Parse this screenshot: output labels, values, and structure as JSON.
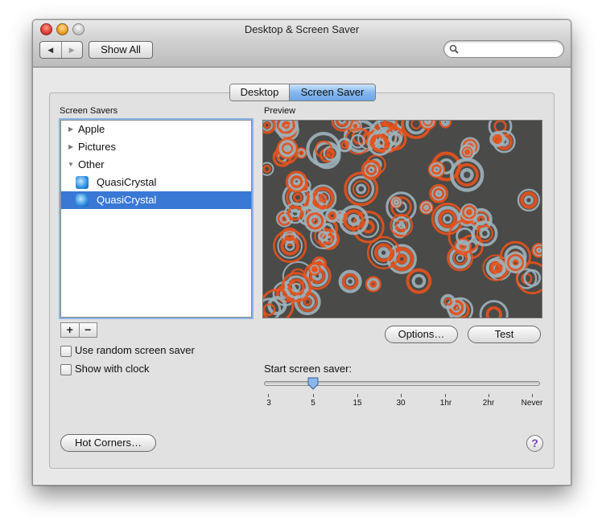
{
  "window": {
    "title": "Desktop & Screen Saver"
  },
  "toolbar": {
    "back_glyph": "◀",
    "forward_glyph": "▶",
    "show_all_label": "Show All",
    "search_placeholder": ""
  },
  "tabs": [
    {
      "label": "Desktop",
      "selected": false
    },
    {
      "label": "Screen Saver",
      "selected": true
    }
  ],
  "screen_savers": {
    "heading": "Screen Savers",
    "items": [
      {
        "label": "Apple",
        "type": "group",
        "expanded": false
      },
      {
        "label": "Pictures",
        "type": "group",
        "expanded": false
      },
      {
        "label": "Other",
        "type": "group",
        "expanded": true
      },
      {
        "label": "QuasiCrystal",
        "type": "item",
        "icon": "quasicrystal-icon",
        "selected": false
      },
      {
        "label": "QuasiCrystal",
        "type": "item",
        "icon": "quasicrystal-icon",
        "selected": true
      }
    ],
    "add_glyph": "+",
    "remove_glyph": "−"
  },
  "options": {
    "random_label": "Use random screen saver",
    "random_checked": false,
    "clock_label": "Show with clock",
    "clock_checked": false
  },
  "preview": {
    "heading": "Preview",
    "options_label": "Options…",
    "test_label": "Test"
  },
  "start": {
    "label": "Start screen saver:",
    "ticks": [
      "3",
      "5",
      "15",
      "30",
      "1hr",
      "2hr",
      "Never"
    ],
    "selected_tick": "5"
  },
  "footer": {
    "hot_corners_label": "Hot Corners…",
    "help_glyph": "?"
  },
  "colors": {
    "selection": "#3a78d6",
    "pattern_orange": "#e8521c",
    "pattern_gray": "#9fb3bb",
    "pattern_dark": "#4a4a48"
  }
}
